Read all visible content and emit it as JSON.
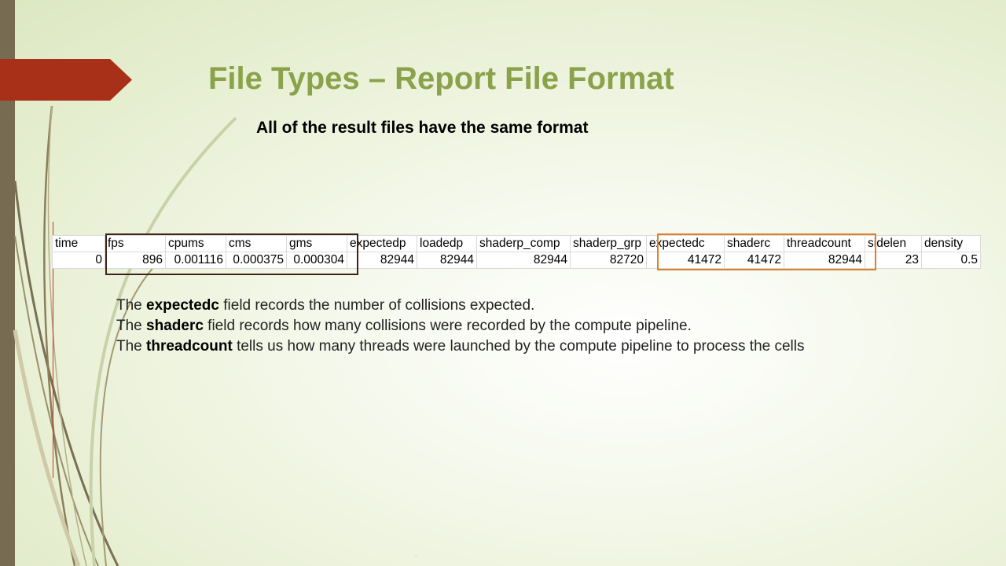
{
  "slide": {
    "title": "File Types – Report File Format",
    "subtitle": "All of the result files have the same format",
    "footer_mark": "."
  },
  "table": {
    "columns": [
      "time",
      "fps",
      "cpums",
      "cms",
      "gms",
      "expectedp",
      "loadedp",
      "shaderp_comp",
      "shaderp_grp",
      "expectedc",
      "shaderc",
      "threadcount",
      "sidelen",
      "density"
    ],
    "row": [
      "0",
      "896",
      "0.001116",
      "0.000375",
      "0.000304",
      "82944",
      "82944",
      "82944",
      "82720",
      "41472",
      "41472",
      "82944",
      "23",
      "0.5"
    ]
  },
  "descriptions": [
    {
      "prefix": "The ",
      "field": "expectedc",
      "text": " field records the number of collisions expected."
    },
    {
      "prefix": "The ",
      "field": "shaderc",
      "text": " field records how many collisions were recorded by the compute pipeline."
    },
    {
      "prefix": "The ",
      "field": "threadcount",
      "text": " tells us how many threads were launched by the compute pipeline to process the cells"
    }
  ],
  "colors": {
    "title": "#8aa24a",
    "sidebar": "#776c52",
    "arrow": "#a83019",
    "highlight_dark": "#3d2418",
    "highlight_orange": "#e07f2a"
  }
}
